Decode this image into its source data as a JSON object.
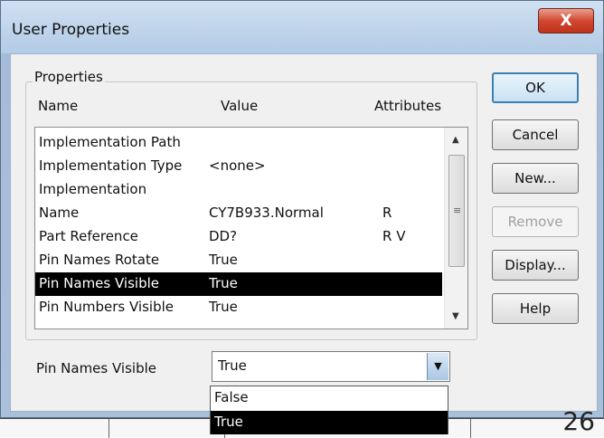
{
  "window": {
    "title": "User Properties",
    "close_glyph": "X"
  },
  "group": {
    "label": "Properties"
  },
  "columns": {
    "name": "Name",
    "value": "Value",
    "attributes": "Attributes"
  },
  "rows": [
    {
      "name": "Implementation Path",
      "value": "",
      "attr": "",
      "selected": false
    },
    {
      "name": "Implementation Type",
      "value": "<none>",
      "attr": "",
      "selected": false
    },
    {
      "name": "Implementation",
      "value": "",
      "attr": "",
      "selected": false
    },
    {
      "name": "Name",
      "value": "CY7B933.Normal",
      "attr": "R",
      "selected": false
    },
    {
      "name": "Part Reference",
      "value": "DD?",
      "attr": "R V",
      "selected": false
    },
    {
      "name": "Pin Names Rotate",
      "value": "True",
      "attr": "",
      "selected": false
    },
    {
      "name": "Pin Names Visible",
      "value": "True",
      "attr": "",
      "selected": true
    },
    {
      "name": "Pin Numbers Visible",
      "value": "True",
      "attr": "",
      "selected": false
    }
  ],
  "buttons": {
    "ok": "OK",
    "cancel": "Cancel",
    "new": "New...",
    "remove": "Remove",
    "display": "Display...",
    "help": "Help"
  },
  "editor": {
    "label": "Pin Names Visible",
    "value": "True",
    "options": [
      "False",
      "True"
    ],
    "selected_option": "True"
  },
  "background": {
    "page_number": "26"
  },
  "icons": {
    "close": "close-icon",
    "scroll_up": "scroll-up-icon",
    "scroll_down": "scroll-down-icon",
    "dropdown": "chevron-down-icon"
  },
  "colors": {
    "selection": "#000000",
    "close_button": "#c9402a",
    "default_button_border": "#3c7fb1"
  }
}
